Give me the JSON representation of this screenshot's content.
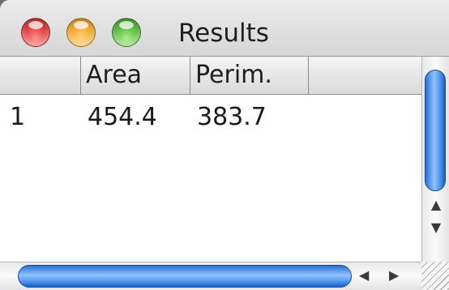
{
  "window": {
    "title": "Results"
  },
  "table": {
    "columns": [
      "",
      "Area",
      "Perim.",
      ""
    ],
    "rows": [
      {
        "index": "1",
        "area": "454.4",
        "perim": "383.7"
      }
    ]
  },
  "scroll": {
    "up_arrow": "▲",
    "down_arrow": "▼",
    "left_arrow": "◀",
    "right_arrow": "▶"
  }
}
